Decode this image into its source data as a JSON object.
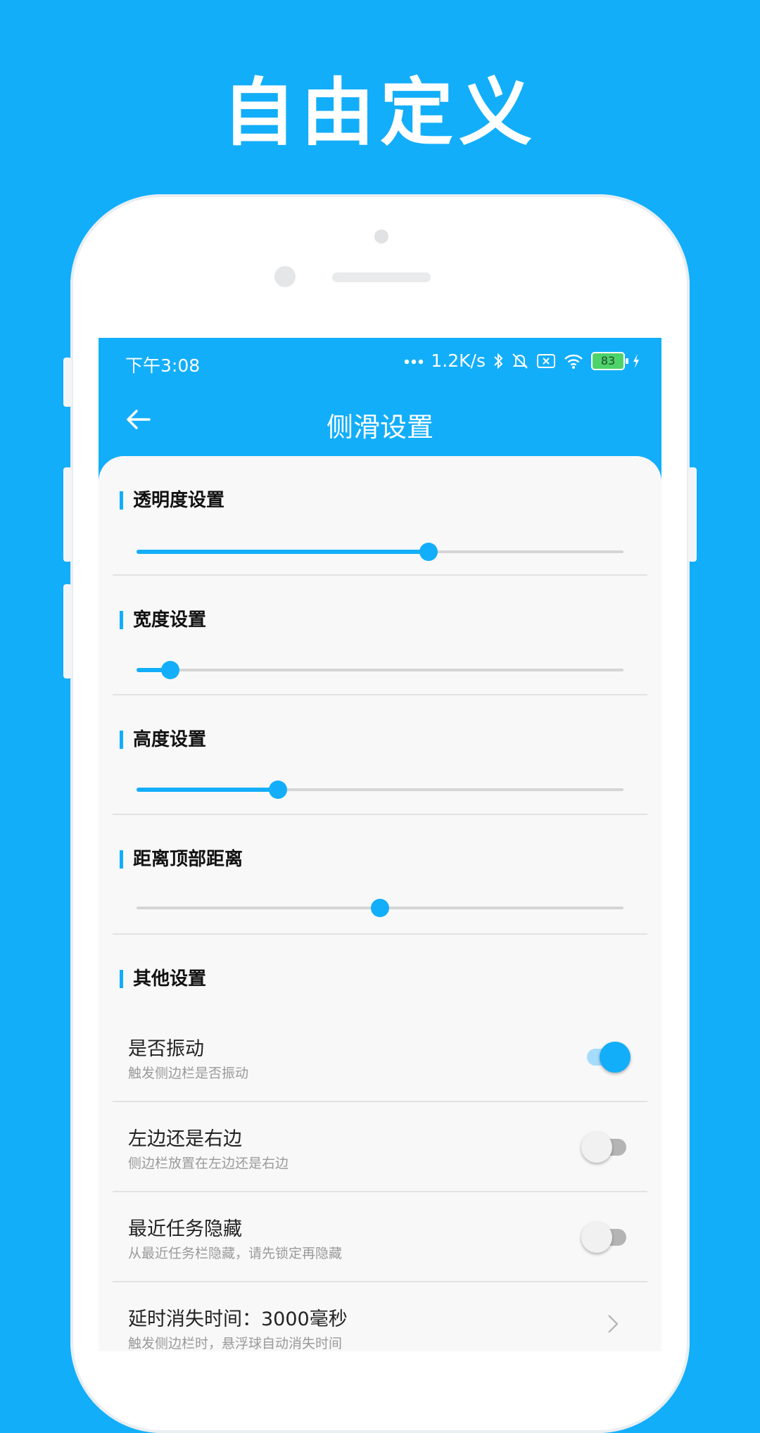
{
  "headline": "自由定义",
  "status_bar": {
    "time": "下午3:08",
    "network_speed": "1.2K/s",
    "battery": "83",
    "icons": [
      "more-dots-icon",
      "bluetooth-icon",
      "mute-icon",
      "sim-off-icon",
      "wifi-icon",
      "battery-icon",
      "charging-icon"
    ]
  },
  "app_bar": {
    "title": "侧滑设置",
    "back_icon": "arrow-back-icon"
  },
  "colors": {
    "accent": "#12aefa",
    "background": "#f8f8f8",
    "track": "#d5d5d5"
  },
  "sliders": [
    {
      "title": "透明度设置",
      "value": 0.6
    },
    {
      "title": "宽度设置",
      "value": 0.07
    },
    {
      "title": "高度设置",
      "value": 0.29
    },
    {
      "title": "距离顶部距离",
      "value": 0.5
    }
  ],
  "other_settings": {
    "title": "其他设置",
    "items": [
      {
        "title": "是否振动",
        "subtitle": "触发侧边栏是否振动",
        "control": "switch",
        "on": true
      },
      {
        "title": "左边还是右边",
        "subtitle": "侧边栏放置在左边还是右边",
        "control": "switch",
        "on": false
      },
      {
        "title": "最近任务隐藏",
        "subtitle": "从最近任务栏隐藏，请先锁定再隐藏",
        "control": "switch",
        "on": false
      },
      {
        "title": "延时消失时间：3000毫秒",
        "subtitle": "触发侧边栏时，悬浮球自动消失时间",
        "control": "chevron"
      }
    ]
  }
}
